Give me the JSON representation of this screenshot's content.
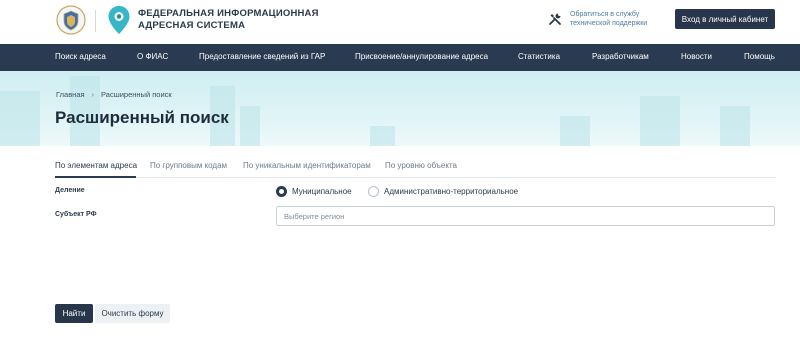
{
  "header": {
    "logo_line1": "ФЕДЕРАЛЬНАЯ ИНФОРМАЦИОННАЯ",
    "logo_line2": "АДРЕСНАЯ СИСТЕМА",
    "support_line1": "Обратиться в службу",
    "support_line2": "технической поддержки",
    "support_icon": "tools-icon",
    "login_label": "Вход в личный кабинет"
  },
  "nav": {
    "items": [
      "Поиск адреса",
      "О ФИАС",
      "Предоставление сведений из ГАР",
      "Присвоение/аннулирование адреса",
      "Статистика",
      "Разработчикам",
      "Новости",
      "Помощь"
    ]
  },
  "breadcrumb": {
    "home": "Главная",
    "current": "Расширенный поиск"
  },
  "page": {
    "title": "Расширенный поиск"
  },
  "tabs": [
    "По элементам адреса",
    "По групповым кодам",
    "По уникальным идентификаторам",
    "По уровню объекта"
  ],
  "form": {
    "division_label": "Деление",
    "division_options": [
      "Муниципальное",
      "Административно-территориальное"
    ],
    "division_selected": "Муниципальное",
    "subject_label": "Субъект РФ",
    "subject_placeholder": "Выберите регион"
  },
  "actions": {
    "find_label": "Найти",
    "clear_label": "Очистить форму"
  },
  "colors": {
    "primary": "#27364b",
    "nav_bg": "#2a3a50",
    "hero_bg": "#d8f1f4",
    "link": "#4a7aa8"
  }
}
